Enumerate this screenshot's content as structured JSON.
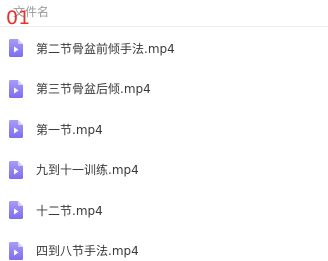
{
  "header": {
    "column_label": "文件名",
    "step_marker": "01"
  },
  "files": [
    {
      "name": "第二节骨盆前倾手法.mp4",
      "icon": "video-file-icon"
    },
    {
      "name": "第三节骨盆后倾.mp4",
      "icon": "video-file-icon"
    },
    {
      "name": "第一节.mp4",
      "icon": "video-file-icon"
    },
    {
      "name": "九到十一训练.mp4",
      "icon": "video-file-icon"
    },
    {
      "name": "十二节.mp4",
      "icon": "video-file-icon"
    },
    {
      "name": "四到八节手法.mp4",
      "icon": "video-file-icon"
    }
  ],
  "colors": {
    "icon_gradient_top": "#a79cf7",
    "icon_gradient_bottom": "#7c6ef0",
    "step_marker": "#e8322e"
  }
}
